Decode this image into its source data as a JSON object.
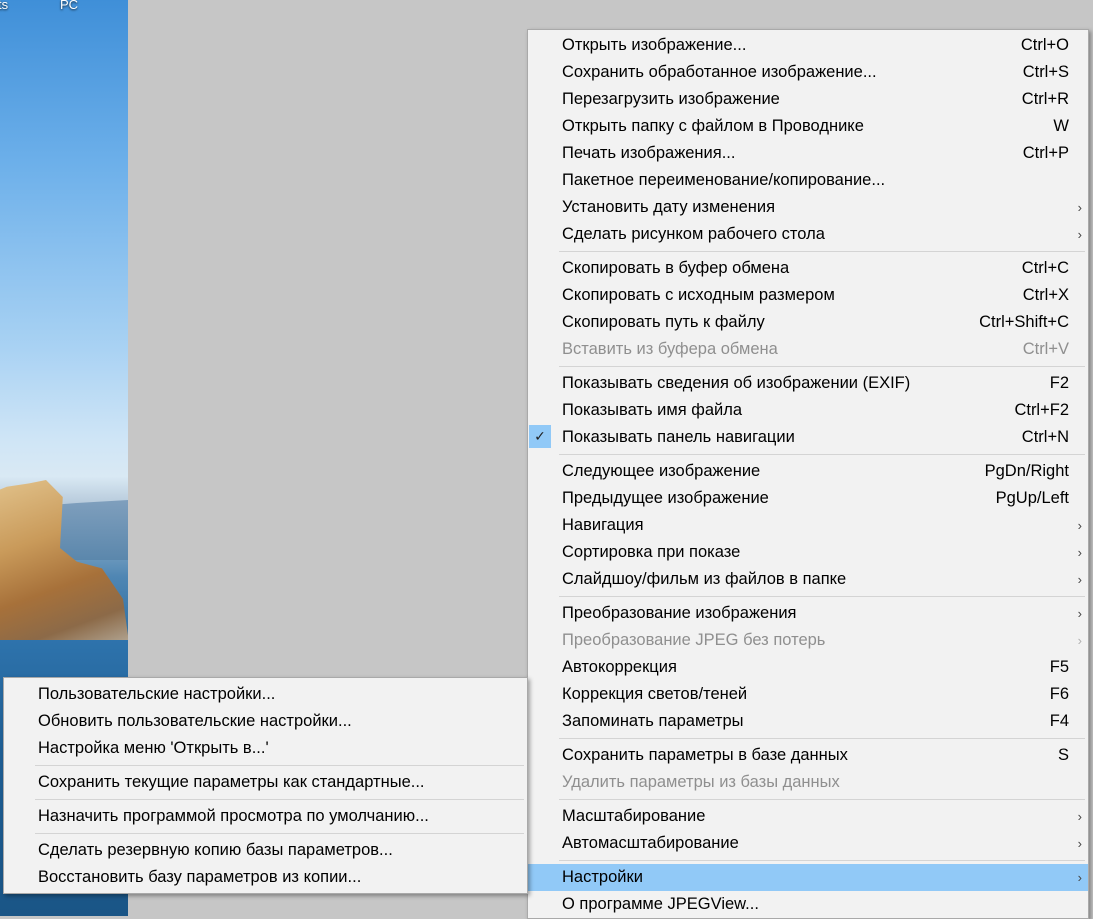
{
  "desktop": {
    "icon_labels": [
      "ts",
      "PC"
    ]
  },
  "context_menu": {
    "groups": [
      [
        {
          "label": "Открыть изображение...",
          "shortcut": "Ctrl+O"
        },
        {
          "label": "Сохранить обработанное изображение...",
          "shortcut": "Ctrl+S"
        },
        {
          "label": "Перезагрузить изображение",
          "shortcut": "Ctrl+R"
        },
        {
          "label": "Открыть папку с файлом в Проводнике",
          "shortcut": "W"
        },
        {
          "label": "Печать изображения...",
          "shortcut": "Ctrl+P"
        },
        {
          "label": "Пакетное переименование/копирование...",
          "shortcut": ""
        },
        {
          "label": "Установить дату изменения",
          "shortcut": "",
          "submenu": true
        },
        {
          "label": "Сделать рисунком рабочего стола",
          "shortcut": "",
          "submenu": true
        }
      ],
      [
        {
          "label": "Скопировать в буфер обмена",
          "shortcut": "Ctrl+C"
        },
        {
          "label": "Скопировать с исходным размером",
          "shortcut": "Ctrl+X"
        },
        {
          "label": "Скопировать путь к файлу",
          "shortcut": "Ctrl+Shift+C"
        },
        {
          "label": "Вставить из буфера обмена",
          "shortcut": "Ctrl+V",
          "disabled": true
        }
      ],
      [
        {
          "label": "Показывать сведения об изображении (EXIF)",
          "shortcut": "F2"
        },
        {
          "label": "Показывать имя файла",
          "shortcut": "Ctrl+F2"
        },
        {
          "label": "Показывать панель навигации",
          "shortcut": "Ctrl+N",
          "checked": true
        }
      ],
      [
        {
          "label": "Следующее изображение",
          "shortcut": "PgDn/Right"
        },
        {
          "label": "Предыдущее изображение",
          "shortcut": "PgUp/Left"
        },
        {
          "label": "Навигация",
          "shortcut": "",
          "submenu": true
        },
        {
          "label": "Сортировка при показе",
          "shortcut": "",
          "submenu": true
        },
        {
          "label": "Слайдшоу/фильм из файлов в папке",
          "shortcut": "",
          "submenu": true
        }
      ],
      [
        {
          "label": "Преобразование изображения",
          "shortcut": "",
          "submenu": true
        },
        {
          "label": "Преобразование JPEG без потерь",
          "shortcut": "",
          "submenu": true,
          "disabled": true
        },
        {
          "label": "Автокоррекция",
          "shortcut": "F5"
        },
        {
          "label": "Коррекция светов/теней",
          "shortcut": "F6"
        },
        {
          "label": "Запоминать параметры",
          "shortcut": "F4"
        }
      ],
      [
        {
          "label": "Сохранить параметры в базе данных",
          "shortcut": "S"
        },
        {
          "label": "Удалить параметры из базы данных",
          "shortcut": "",
          "disabled": true
        }
      ],
      [
        {
          "label": "Масштабирование",
          "shortcut": "",
          "submenu": true
        },
        {
          "label": "Автомасштабирование",
          "shortcut": "",
          "submenu": true
        }
      ],
      [
        {
          "label": "Настройки",
          "shortcut": "",
          "submenu": true,
          "highlighted": true
        },
        {
          "label": "О программе JPEGView...",
          "shortcut": ""
        }
      ]
    ]
  },
  "settings_submenu": {
    "groups": [
      [
        {
          "label": "Пользовательские настройки..."
        },
        {
          "label": "Обновить пользовательские настройки..."
        },
        {
          "label": "Настройка меню 'Открыть в...'"
        }
      ],
      [
        {
          "label": "Сохранить текущие параметры как стандартные..."
        }
      ],
      [
        {
          "label": "Назначить программой просмотра по умолчанию..."
        }
      ],
      [
        {
          "label": "Сделать резервную копию базы параметров..."
        },
        {
          "label": "Восстановить базу параметров из копии..."
        }
      ]
    ]
  },
  "icons": {
    "check": "✓",
    "submenu_arrow": "›"
  },
  "colors": {
    "menu_bg": "#f2f2f2",
    "highlight": "#91c9f7",
    "disabled_text": "#8f8f8f",
    "viewer_bg": "#c6c6c6"
  }
}
